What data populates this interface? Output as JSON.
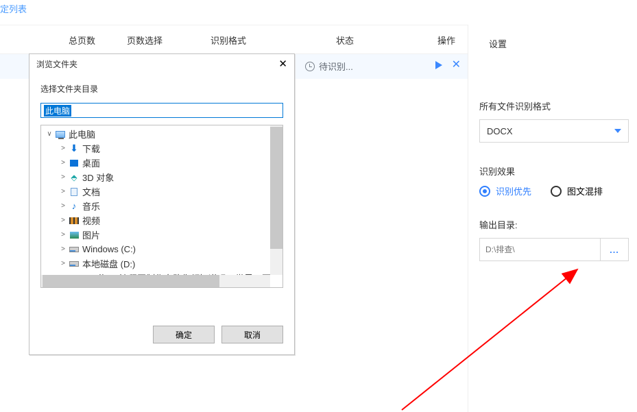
{
  "top_link": "定列表",
  "table": {
    "headers": {
      "pages": "总页数",
      "sel": "页数选择",
      "fmt": "识别格式",
      "status": "状态",
      "op": "操作"
    },
    "row_status": "待识别..."
  },
  "side": {
    "title": "设置",
    "format_label": "所有文件识别格式",
    "format_value": "DOCX",
    "effect_label": "识别效果",
    "radio_priority": "识别优先",
    "radio_mixed": "图文混排",
    "output_label": "输出目录:",
    "output_value": "D:\\排查\\",
    "browse_btn": "..."
  },
  "dialog": {
    "title": "浏览文件夹",
    "subtitle": "选择文件夹目录",
    "input_value": "此电脑",
    "ok": "确定",
    "cancel": "取消",
    "tree": [
      {
        "indent": 0,
        "exp": "∨",
        "icon": "pc",
        "label": "此电脑"
      },
      {
        "indent": 1,
        "exp": ">",
        "icon": "dl",
        "label": "下载"
      },
      {
        "indent": 1,
        "exp": ">",
        "icon": "desk",
        "label": "桌面"
      },
      {
        "indent": 1,
        "exp": ">",
        "icon": "3d",
        "label": "3D 对象"
      },
      {
        "indent": 1,
        "exp": ">",
        "icon": "doc",
        "label": "文档"
      },
      {
        "indent": 1,
        "exp": ">",
        "icon": "music",
        "label": "音乐"
      },
      {
        "indent": 1,
        "exp": ">",
        "icon": "vid",
        "label": "视频"
      },
      {
        "indent": 1,
        "exp": ">",
        "icon": "pic",
        "label": "图片"
      },
      {
        "indent": 1,
        "exp": ">",
        "icon": "drv",
        "label": "Windows (C:)"
      },
      {
        "indent": 1,
        "exp": ">",
        "icon": "drv",
        "label": "本地磁盘 (D:)"
      },
      {
        "indent": 2,
        "exp": ">",
        "icon": "fold",
        "label": "丁海云-流程图制作套路你都知道吗？世界五百强都在"
      }
    ]
  }
}
